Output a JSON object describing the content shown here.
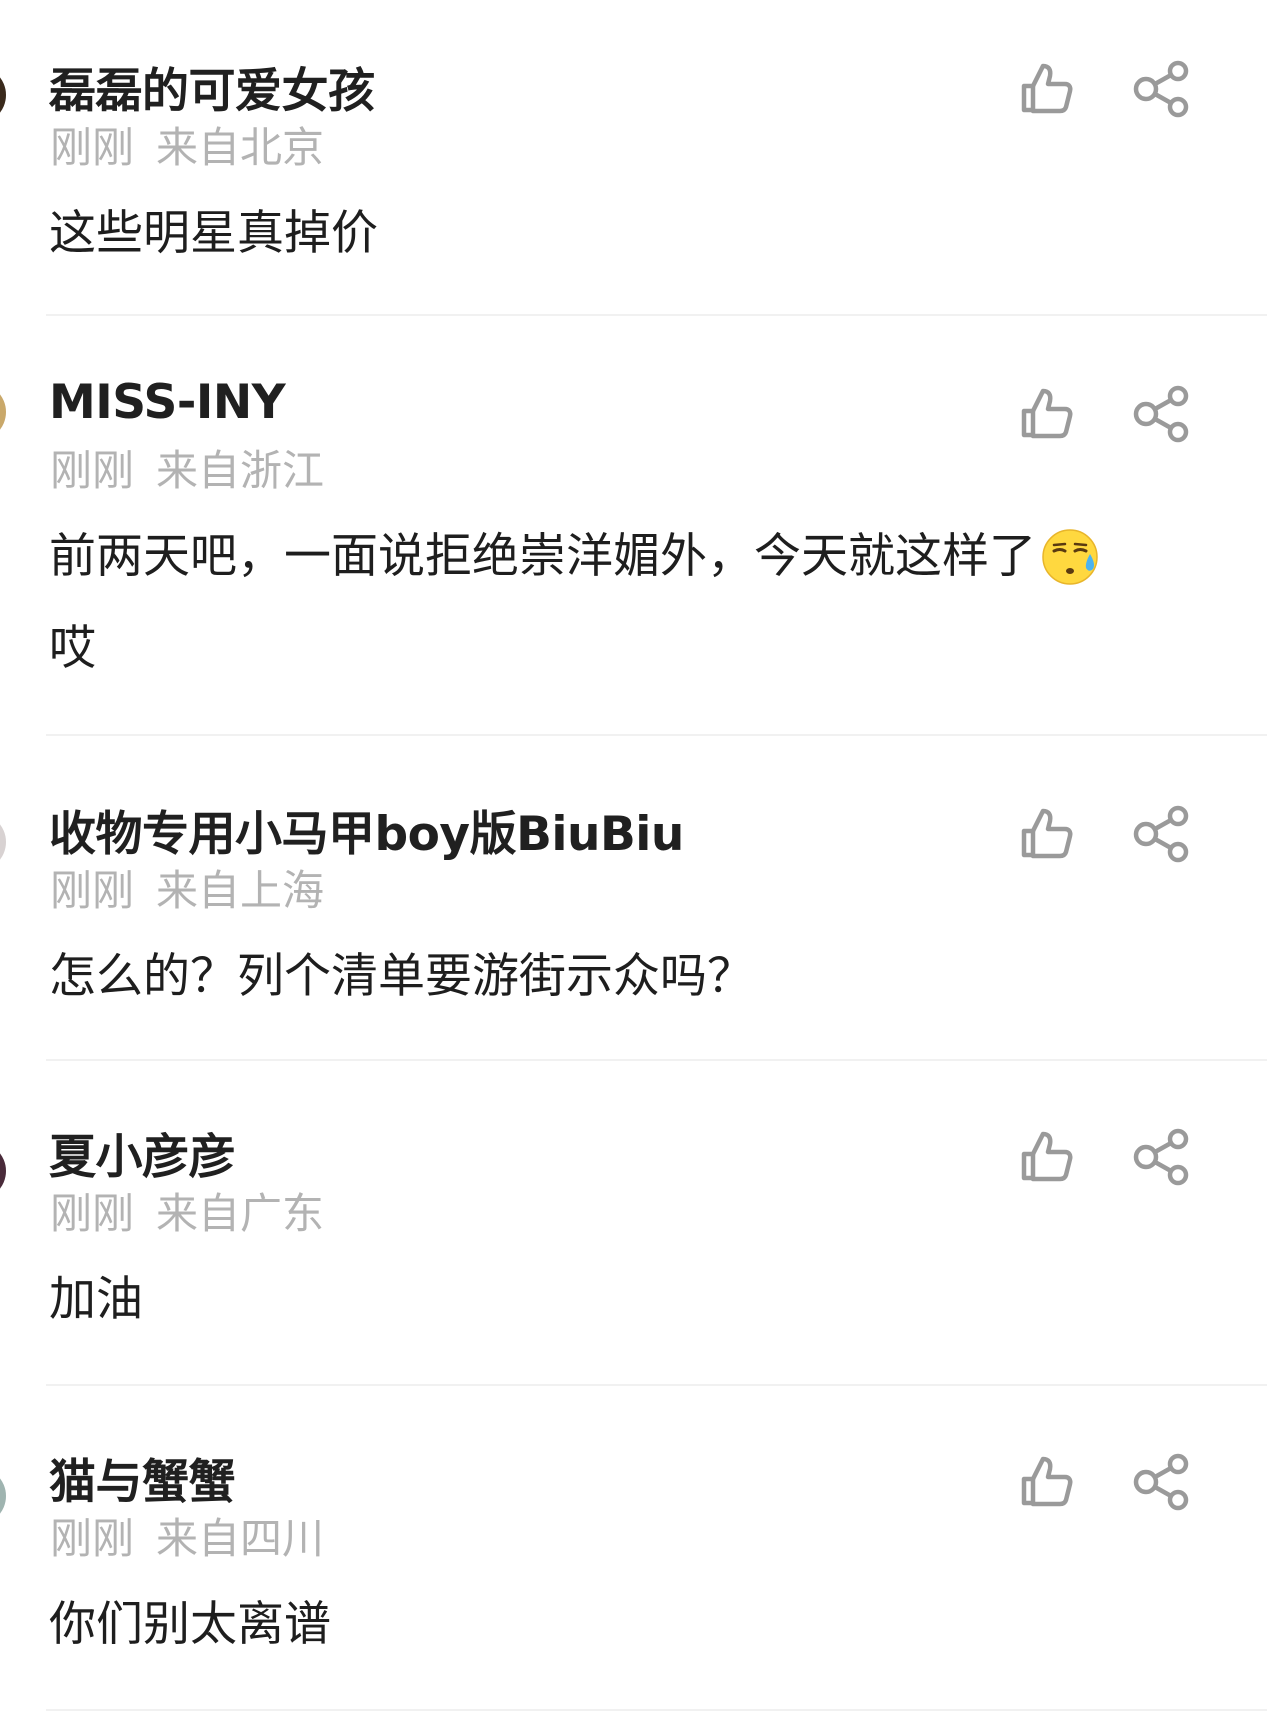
{
  "comments": [
    {
      "username": "磊磊的可爱女孩",
      "time": "刚刚",
      "location": "来自北京",
      "text": "这些明星真掉价",
      "avatar_color": "#3a2a1c",
      "like_icon": "thumbs-up-icon",
      "share_icon": "share-icon"
    },
    {
      "username": "MISS-INY",
      "time": "刚刚",
      "location": "来自浙江",
      "text": "前两天吧，一面说拒绝崇洋媚外，今天就这样了",
      "text_line2": "哎",
      "emoji": "sweat-face-emoji",
      "avatar_color": "#c9a86a",
      "like_icon": "thumbs-up-icon",
      "share_icon": "share-icon"
    },
    {
      "username": "收物专用小马甲boy版BiuBiu",
      "time": "刚刚",
      "location": "来自上海",
      "text": "怎么的？列个清单要游街示众吗？",
      "avatar_color": "#d8d2d2",
      "like_icon": "thumbs-up-icon",
      "share_icon": "share-icon"
    },
    {
      "username": "夏小彦彦",
      "time": "刚刚",
      "location": "来自广东",
      "text": "加油",
      "avatar_color": "#4a2b3a",
      "like_icon": "thumbs-up-icon",
      "share_icon": "share-icon"
    },
    {
      "username": "猫与蟹蟹",
      "time": "刚刚",
      "location": "来自四川",
      "text": "你们别太离谱",
      "avatar_color": "#9fb4b0",
      "like_icon": "thumbs-up-icon",
      "share_icon": "share-icon"
    }
  ],
  "colors": {
    "icon_gray": "#9a9a9a",
    "meta_gray": "#b3b3b3",
    "divider": "#f1f1f1"
  }
}
